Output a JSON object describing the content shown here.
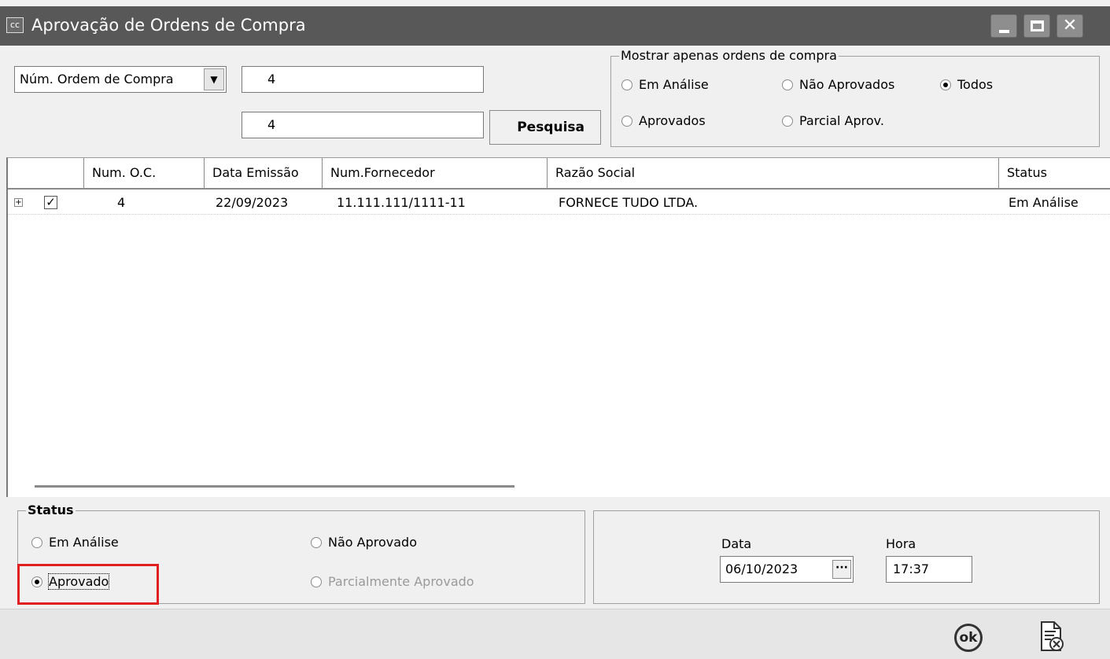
{
  "window": {
    "icon_text": "cc",
    "title": "Aprovação de Ordens de Compra"
  },
  "search": {
    "field_select": "Núm. Ordem de Compra",
    "from_value": "4",
    "to_value": "4",
    "button_label": "Pesquisa"
  },
  "filter": {
    "title": "Mostrar apenas ordens de compra",
    "options": [
      {
        "label": "Em Análise",
        "selected": false
      },
      {
        "label": "Não Aprovados",
        "selected": false
      },
      {
        "label": "Todos",
        "selected": true
      },
      {
        "label": "Aprovados",
        "selected": false
      },
      {
        "label": "Parcial Aprov.",
        "selected": false
      }
    ]
  },
  "grid": {
    "columns": [
      "",
      "Num. O.C.",
      "Data Emissão",
      "Num.Fornecedor",
      "Razão Social",
      "Status"
    ],
    "rows": [
      {
        "expander": "+",
        "checked": "✓",
        "num_oc": "4",
        "data_emissao": "22/09/2023",
        "num_fornecedor": "11.111.111/1111-11",
        "razao_social": "FORNECE TUDO LTDA.",
        "status": "Em Análise"
      }
    ]
  },
  "status_group": {
    "title": "Status",
    "options": [
      {
        "label": "Em Análise",
        "selected": false,
        "disabled": false
      },
      {
        "label": "Não Aprovado",
        "selected": false,
        "disabled": false
      },
      {
        "label": "Aprovado",
        "selected": true,
        "disabled": false
      },
      {
        "label": "Parcialmente Aprovado",
        "selected": false,
        "disabled": true
      }
    ]
  },
  "datetime": {
    "date_label": "Data",
    "date_value": "06/10/2023",
    "date_button": "···",
    "time_label": "Hora",
    "time_value": "17:37"
  },
  "toolbar": {
    "ok_label": "ok",
    "highlight_color": "#e02020"
  }
}
